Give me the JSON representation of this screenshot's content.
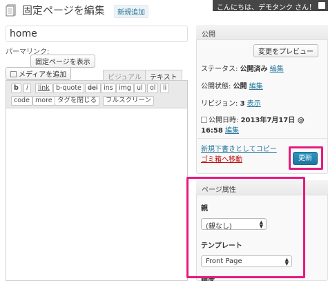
{
  "header": {
    "title": "固定ページを編集",
    "add_new": "新規追加",
    "howdy": "こんにちは、デモタンク さん！"
  },
  "editor": {
    "title_value": "home",
    "permalink_label": "パーマリンク:",
    "show_page": "固定ページを表示",
    "add_media": "メディアを追加",
    "tabs": [
      "ビジュアル",
      "テキスト"
    ],
    "quicktags": [
      "b",
      "i",
      "link",
      "b-quote",
      "del",
      "ins",
      "img",
      "ul",
      "ol",
      "li",
      "code",
      "more",
      "タグを閉じる",
      "フルスクリーン"
    ]
  },
  "publish": {
    "heading": "公開",
    "preview": "変更をプレビュー",
    "status_label": "ステータス:",
    "status_value": "公開済み",
    "status_edit": "編集",
    "visibility_label": "公開状態:",
    "visibility_value": "公開",
    "visibility_edit": "編集",
    "revisions_label": "リビジョン:",
    "revisions_value": "3",
    "revisions_view": "表示",
    "date_label": "公開日時:",
    "date_value": "2013年7月17日 @",
    "time_value": "16:58",
    "date_edit": "編集",
    "copy_draft": "新規下書きとしてコピー",
    "trash": "ゴミ箱へ移動",
    "update": "更新"
  },
  "attributes": {
    "heading": "ページ属性",
    "parent_label": "親",
    "parent_value": "(親なし)",
    "template_label": "テンプレート",
    "template_value": "Front Page",
    "order_label": "順序"
  },
  "colors": {
    "highlight": "#e6197e",
    "link": "#21759b",
    "trash": "#bc0b0b",
    "update_button": "#21759b"
  }
}
